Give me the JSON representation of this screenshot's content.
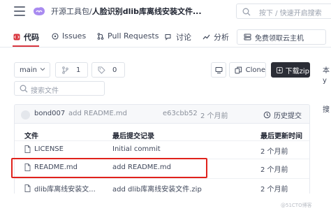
{
  "header": {
    "owner": "开源工具包",
    "separator": "/",
    "repo": "人脸识别dlib库离线安装文件...",
    "search_placeholder": "按下 / 快速开启搜索"
  },
  "tabs": [
    {
      "label": "代码",
      "icon": "code-icon",
      "active": true
    },
    {
      "label": "Issues",
      "icon": "issues-icon"
    },
    {
      "label": "Pull Requests",
      "icon": "pull-request-icon"
    },
    {
      "label": "讨论",
      "icon": "discussion-icon"
    },
    {
      "label": "分析",
      "icon": "analytics-icon"
    }
  ],
  "cloud_host_label": "免费领取云主机",
  "toolbar": {
    "branch": "main",
    "branch_count": "1",
    "tag_count": "0",
    "clone_label": "Clone",
    "download_label": "下载zip"
  },
  "file_search_placeholder": "搜索文件",
  "latest_commit": {
    "author": "bond007",
    "message": "add README.md",
    "hash": "e63cbb52",
    "time": "2 个月前",
    "history_label": "历史提交"
  },
  "table": {
    "headers": [
      "文件",
      "最后提交记录",
      "最后更新时间"
    ],
    "rows": [
      {
        "name": "LICENSE",
        "message": "Initial commit",
        "time": "2 个月前"
      },
      {
        "name": "README.md",
        "message": "add README.md",
        "time": "2 个月前"
      },
      {
        "name": "dlib库离线安装文...",
        "message": "add dlib库离线安装文件.zip",
        "time": "2 个月前"
      }
    ]
  },
  "right_panel_clip": [
    "本",
    "y",
    "搜"
  ],
  "watermark": "@51CTO博客",
  "colors": {
    "accent_red": "#d9363e",
    "highlight_box": "#e0221c",
    "download_bg": "#2b2d36"
  }
}
